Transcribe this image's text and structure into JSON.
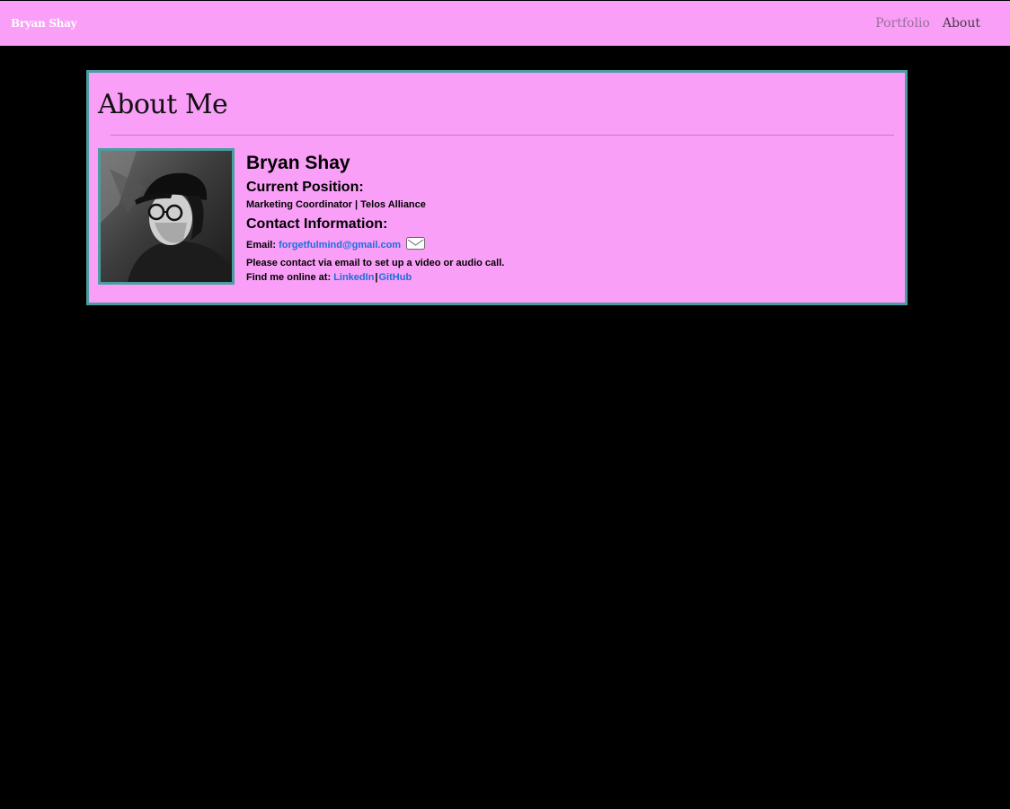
{
  "navbar": {
    "brand": "Bryan Shay",
    "links": [
      {
        "label": "Portfolio"
      },
      {
        "label": "About"
      }
    ],
    "background": "#f99ff7"
  },
  "page": {
    "title": "About Me",
    "background": "#000000"
  },
  "profile": {
    "name": "Bryan Shay",
    "current_position_heading": "Current Position:",
    "current_position": "Marketing Coordinator | Telos Alliance",
    "contact_heading": "Contact Information:",
    "email_label": "Email:",
    "email": "forgetfulmind@gmail.com",
    "email_icon": "envelope-icon",
    "contact_note": "Please contact via email to set up a video or audio call.",
    "find_online_label": "Find me online at:",
    "links": [
      {
        "label": "LinkedIn"
      },
      {
        "label": "GitHub"
      }
    ],
    "separator": "|"
  },
  "colors": {
    "card_background": "#f99ff7",
    "card_border": "#4a9da0",
    "link": "#1a6fe0"
  }
}
